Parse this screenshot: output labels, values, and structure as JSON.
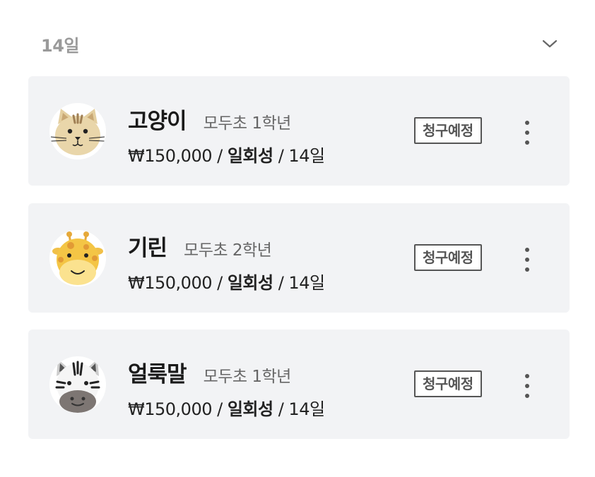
{
  "section": {
    "title": "14일",
    "collapse_icon": "chevron-down-icon"
  },
  "students": [
    {
      "name": "고양이",
      "school": "모두초 1학년",
      "price": "₩150,000",
      "separator1": " / ",
      "frequency": "일회성",
      "separator2": " / ",
      "day": "14일",
      "status": "청구예정",
      "avatar_icon": "cat-icon"
    },
    {
      "name": "기린",
      "school": "모두초 2학년",
      "price": "₩150,000",
      "separator1": " / ",
      "frequency": "일회성",
      "separator2": " / ",
      "day": "14일",
      "status": "청구예정",
      "avatar_icon": "giraffe-icon"
    },
    {
      "name": "얼룩말",
      "school": "모두초 1학년",
      "price": "₩150,000",
      "separator1": " / ",
      "frequency": "일회성",
      "separator2": " / ",
      "day": "14일",
      "status": "청구예정",
      "avatar_icon": "zebra-icon"
    }
  ],
  "colors": {
    "card_bg": "#f2f3f5",
    "header_text": "#9a9a9a",
    "badge_border": "#555555"
  }
}
